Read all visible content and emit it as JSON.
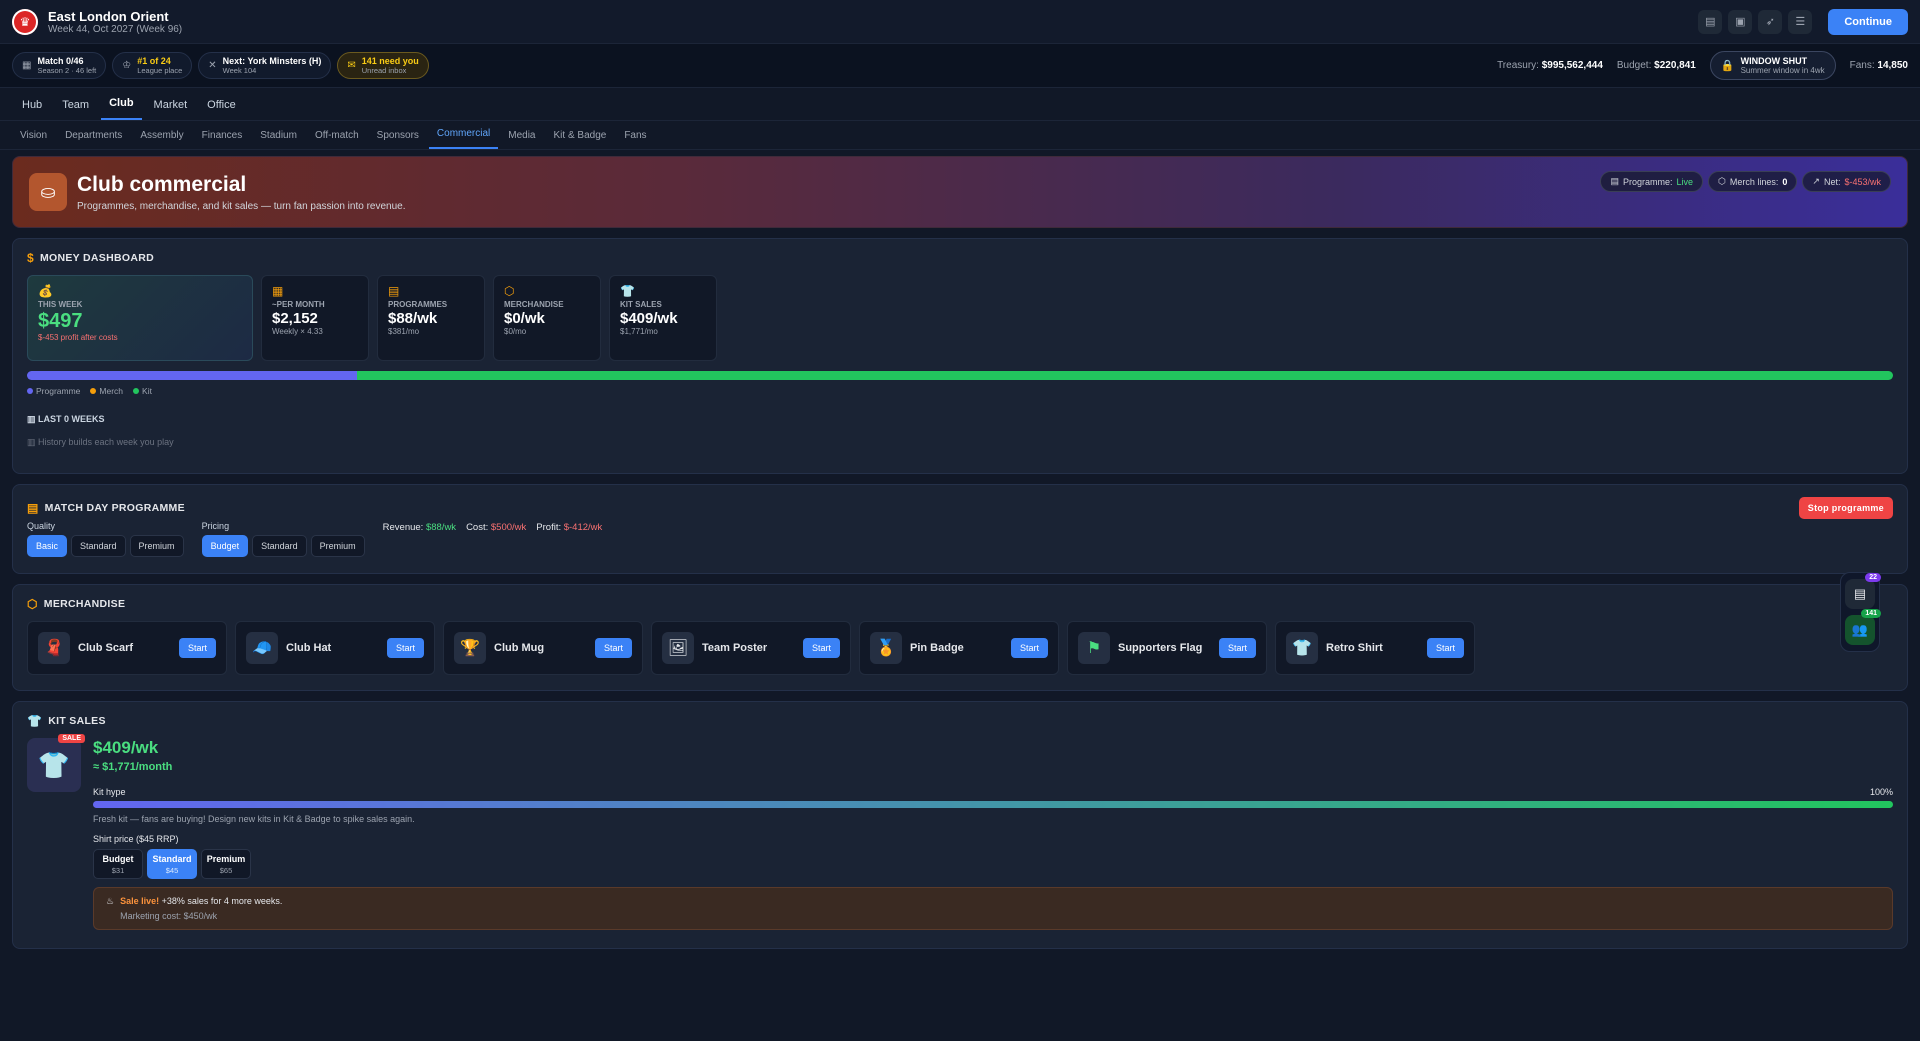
{
  "club": {
    "name": "East London Orient",
    "week": "Week 44, Oct 2027 (Week 96)"
  },
  "status": {
    "match": "Match 0/46",
    "season": "Season 2 · 46 left",
    "league": "#1 of 24",
    "league_sub": "League place",
    "next": "Next: York Minsters (H)",
    "next_sub": "Week 104",
    "inbox": "141 need you",
    "inbox_sub": "Unread inbox",
    "treasury_label": "Treasury:",
    "treasury": "$995,562,444",
    "budget_label": "Budget:",
    "budget": "$220,841",
    "window_title": "WINDOW SHUT",
    "window_sub": "Summer window in 4wk",
    "fans_label": "Fans:",
    "fans": "14,850",
    "continue": "Continue"
  },
  "nav": [
    "Hub",
    "Team",
    "Club",
    "Market",
    "Office"
  ],
  "subnav": [
    "Vision",
    "Departments",
    "Assembly",
    "Finances",
    "Stadium",
    "Off-match",
    "Sponsors",
    "Commercial",
    "Media",
    "Kit & Badge",
    "Fans"
  ],
  "hero": {
    "title": "Club commercial",
    "sub": "Programmes, merchandise, and kit sales — turn fan passion into revenue.",
    "programme_label": "Programme:",
    "programme": "Live",
    "merch_label": "Merch lines:",
    "merch": "0",
    "net_label": "Net:",
    "net": "$-453/wk"
  },
  "dashboard": {
    "title": "MONEY DASHBOARD",
    "this_week_label": "THIS WEEK",
    "this_week": "$497",
    "profit": "$-453 profit after costs",
    "tiles": [
      {
        "label": "~PER MONTH",
        "value": "$2,152",
        "sub": "Weekly × 4.33"
      },
      {
        "label": "PROGRAMMES",
        "value": "$88/wk",
        "sub": "$381/mo"
      },
      {
        "label": "MERCHANDISE",
        "value": "$0/wk",
        "sub": "$0/mo"
      },
      {
        "label": "KIT SALES",
        "value": "$409/wk",
        "sub": "$1,771/mo"
      }
    ],
    "legend": [
      "Programme",
      "Merch",
      "Kit"
    ],
    "history_title": "LAST 0 WEEKS",
    "history_empty": "History builds each week you play"
  },
  "programme": {
    "title": "MATCH DAY PROGRAMME",
    "quality_label": "Quality",
    "quality": [
      "Basic",
      "Standard",
      "Premium"
    ],
    "pricing_label": "Pricing",
    "pricing": [
      "Budget",
      "Standard",
      "Premium"
    ],
    "revenue_label": "Revenue:",
    "revenue": "$88/wk",
    "cost_label": "Cost:",
    "cost": "$500/wk",
    "profit_label": "Profit:",
    "profit": "$-412/wk",
    "stop": "Stop programme"
  },
  "merchandise": {
    "title": "MERCHANDISE",
    "items": [
      "Club Scarf",
      "Club Hat",
      "Club Mug",
      "Team Poster",
      "Pin Badge",
      "Supporters Flag",
      "Retro Shirt"
    ],
    "start": "Start"
  },
  "kit": {
    "title": "KIT SALES",
    "sale_tag": "SALE",
    "weekly": "$409/wk",
    "monthly": "≈ $1,771/month",
    "hype_label": "Kit hype",
    "hype_value": "100%",
    "hype_text": "Fresh kit — fans are buying! Design new kits in Kit & Badge to spike sales again.",
    "price_label": "Shirt price ($45 RRP)",
    "prices": [
      {
        "name": "Budget",
        "price": "$31"
      },
      {
        "name": "Standard",
        "price": "$45"
      },
      {
        "name": "Premium",
        "price": "$65"
      }
    ],
    "sale_live": "Sale live!",
    "sale_text": "+38% sales for 4 more weeks.",
    "marketing": "Marketing cost: $450/wk"
  },
  "float": {
    "badge1": "22",
    "badge2": "141"
  },
  "chart_data": {
    "type": "bar",
    "categories": [
      "Programme",
      "Merch",
      "Kit"
    ],
    "values": [
      88,
      0,
      409
    ],
    "colors": [
      "#6366f1",
      "#f59e0b",
      "#22c55e"
    ]
  }
}
